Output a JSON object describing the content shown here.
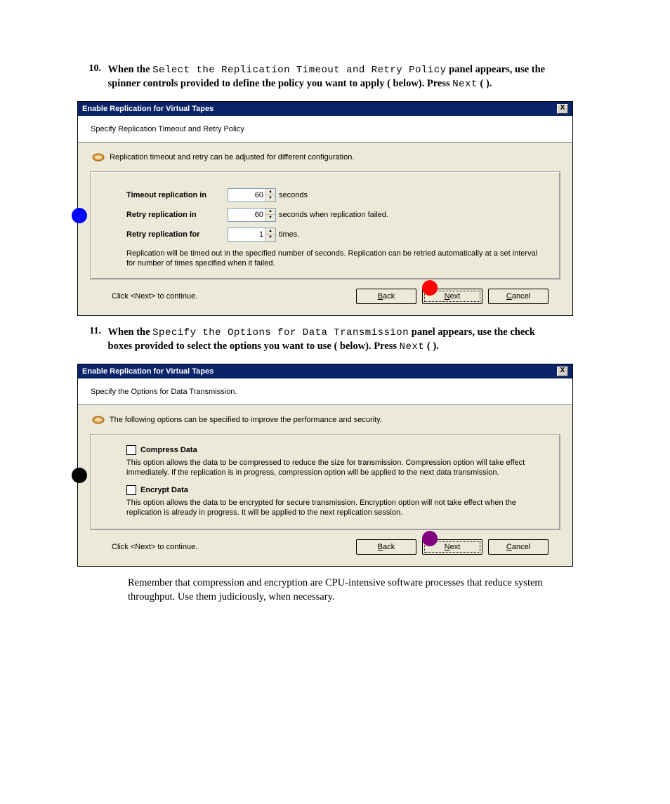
{
  "step10": {
    "num": "10.",
    "prefix_bold": "When the ",
    "panel_name": "Select the Replication Timeout and Retry Policy",
    "after": " panel appears, use the spinner controls provided to define the policy you want to apply (   below). Press ",
    "next_mono": "Next",
    "tail": " (  )."
  },
  "dialog1": {
    "title": "Enable Replication for Virtual Tapes",
    "close": "X",
    "subtitle": "Specify Replication Timeout and Retry Policy",
    "hint": "Replication timeout and retry can be adjusted for different configuration.",
    "timeout_label": "Timeout replication in",
    "timeout_value": "60",
    "timeout_suffix": "seconds",
    "retry_in_label": "Retry replication in",
    "retry_in_value": "60",
    "retry_in_suffix": "seconds when replication failed.",
    "retry_for_label": "Retry replication for",
    "retry_for_value": "1",
    "retry_for_suffix": "times.",
    "help": "Replication will be timed out in the specified number of seconds. Replication can be retried automatically at a set interval for number of times specified when it failed.",
    "continue": "Click <Next> to continue.",
    "back": "Back",
    "next": "Next",
    "cancel": "Cancel"
  },
  "step11": {
    "num": "11.",
    "prefix_bold": "When the ",
    "panel_name": "Specify the Options for Data Transmission",
    "after": " panel appears, use the check boxes provided to select the options you want to use (   below). Press ",
    "next_mono": "Next",
    "tail": " (  )."
  },
  "dialog2": {
    "title": "Enable Replication for Virtual Tapes",
    "close": "X",
    "subtitle": "Specify the Options for Data Transmission.",
    "hint": "The following options can be specified to improve the performance and security.",
    "opt1_title": "Compress Data",
    "opt1_desc": "This option allows the data to be compressed to reduce the size for transmission. Compression option will take effect immediately. If the replication is in progress, compression option will be applied to the next data transmission.",
    "opt2_title": "Encrypt Data",
    "opt2_desc": "This option allows the data to be encrypted for secure transmission. Encryption option will not take effect when the replication is already in progress. It will be applied to the next replication session.",
    "continue": "Click <Next> to continue.",
    "back": "Back",
    "next": "Next",
    "cancel": "Cancel"
  },
  "after_note": "Remember that compression and encryption are CPU-intensive software processes that reduce system throughput. Use them judiciously, when necessary."
}
